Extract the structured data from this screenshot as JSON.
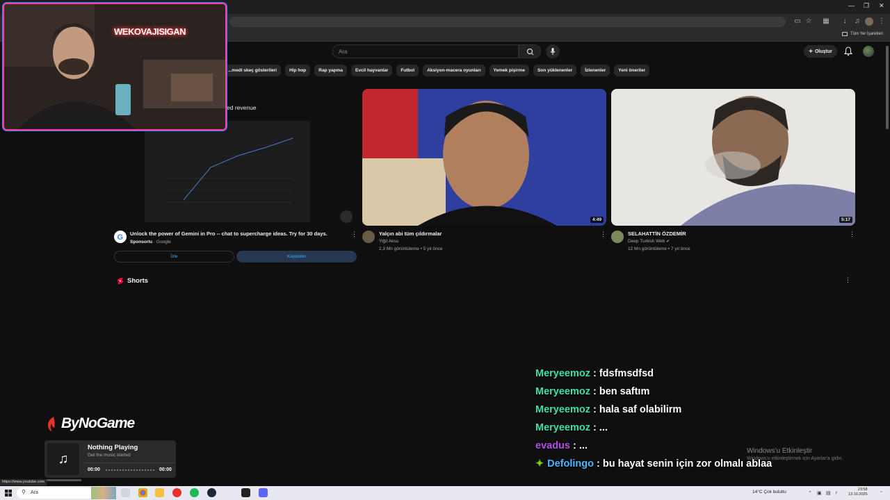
{
  "browser": {
    "bookmarks_all": "Tüm Yer İşaretleri",
    "status_url": "https://www.youtube.com"
  },
  "youtube": {
    "search_placeholder": "Ara",
    "create_label": "Oluştur",
    "chips": [
      "...medi skeç gösterileri",
      "Hip hop",
      "Rap yapma",
      "Evcil hayvanlar",
      "Futbol",
      "Aksiyon-macera oyunları",
      "Yemek pişirme",
      "Son yüklenenler",
      "İzlenenler",
      "Yeni öneriler"
    ],
    "ad": {
      "chart_title": "ed revenue",
      "title": "Unlock the power of Gemini in Pro -- chat to supercharge ideas. Try for 30 days.",
      "sponsored": "Sponsorlu",
      "advertiser": "Google",
      "watch_label": "İzle",
      "subscribe_label": "Kaydolun"
    },
    "videos": [
      {
        "title": "Yalçın abi tüm çıldırmalar",
        "channel": "Yiğit Aksu",
        "stats": "2,3 Mn görüntüleme • 5 yıl önce",
        "duration": "4:49"
      },
      {
        "title": "SELAHATTİN ÖZDEMİR",
        "channel": "Deep Turkish Web",
        "stats": "12 Mn görüntüleme • 7 yıl önce",
        "duration": "5:17"
      }
    ],
    "shorts_label": "Shorts"
  },
  "stream": {
    "neon_sign": "WEKOVAJISIGAN",
    "brand": "ByNoGame",
    "music": {
      "title": "Nothing Playing",
      "subtitle": "Get the music started",
      "time_start": "00:00",
      "time_end": "00:00"
    },
    "chat": [
      {
        "user": "Meryeemoz",
        "color": "#3fe0b0",
        "message": ": fdsfmsdfsd",
        "badge": false
      },
      {
        "user": "Meryeemoz",
        "color": "#3fe0b0",
        "message": ": ben saftım",
        "badge": false
      },
      {
        "user": "Meryeemoz",
        "color": "#3fe0b0",
        "message": ": hala saf olabilirm",
        "badge": false
      },
      {
        "user": "Meryeemoz",
        "color": "#3fe0b0",
        "message": ": ...",
        "badge": false
      },
      {
        "user": "evadus",
        "color": "#b64ee8",
        "message": ": ...",
        "badge": false
      },
      {
        "user": "Defolingo",
        "color": "#4fb4ff",
        "message": ": bu hayat senin için zor olmalı ablaa",
        "badge": true
      }
    ]
  },
  "windows": {
    "activate_title": "Windows'u Etkinleştir",
    "activate_sub": "Windows'u etkinleştirmek için Ayarlar'a gidin.",
    "taskbar_search": "Ara",
    "weather": "14°C  Çok bulutlu",
    "time": "23:58",
    "date": "13.10.2025"
  }
}
